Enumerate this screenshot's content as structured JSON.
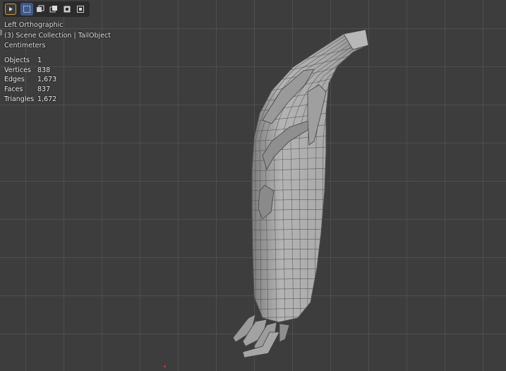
{
  "viewport": {
    "view_name": "Left Orthographic",
    "collection_line": "(3) Scene Collection | TailObject",
    "units": "Centimeters"
  },
  "stats": [
    {
      "label": "Objects",
      "value": "1"
    },
    {
      "label": "Vertices",
      "value": "838"
    },
    {
      "label": "Edges",
      "value": "1,673"
    },
    {
      "label": "Faces",
      "value": "837"
    },
    {
      "label": "Triangles",
      "value": "1,672"
    }
  ],
  "toolbar": {
    "icons": [
      "play-icon",
      "select-box-icon",
      "select-extend-icon",
      "select-subtract-icon",
      "select-invert-icon",
      "select-intersect-icon"
    ]
  },
  "colors": {
    "background": "#3d3d3d",
    "grid": "#505050",
    "mesh_fill": "#a9a9a9",
    "wire": "#3a3a3a",
    "active_tool": "#3d5a8a",
    "origin": "#d03030"
  }
}
